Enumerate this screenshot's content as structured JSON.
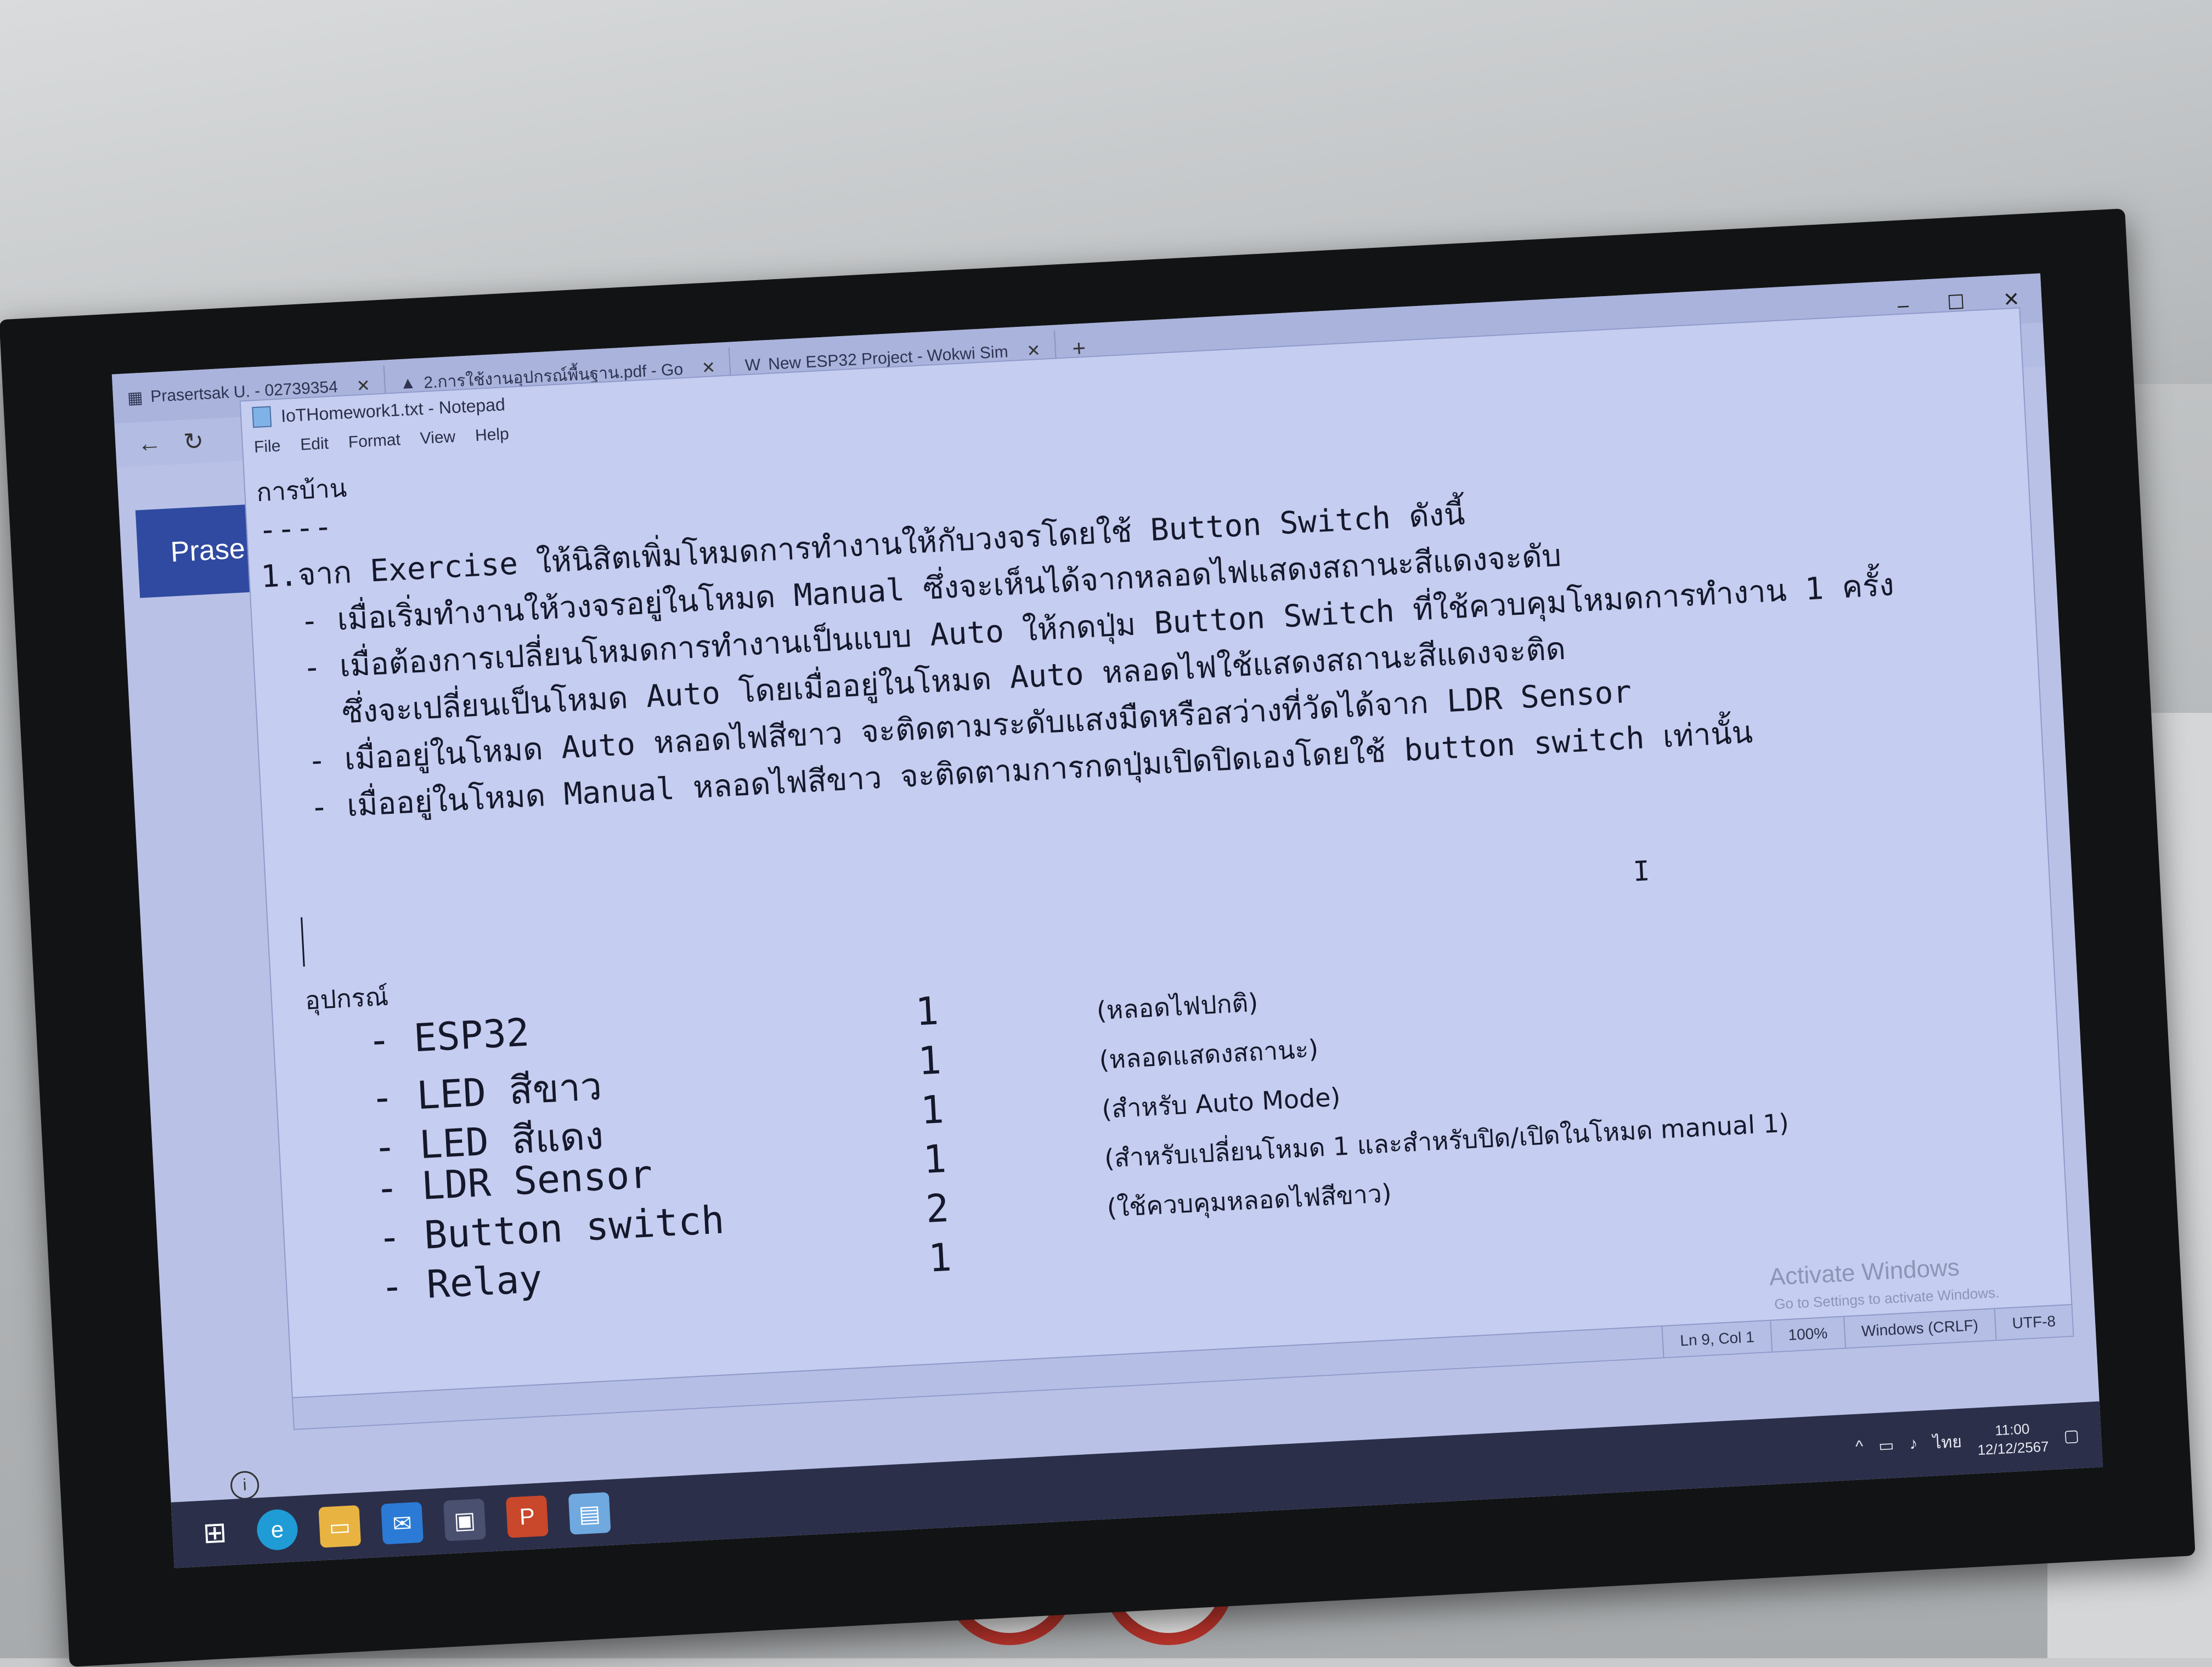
{
  "browser": {
    "tabs": [
      {
        "label": "Prasertsak U. - 02739354"
      },
      {
        "label": "2.การใช้งานอุปกรณ์พื้นฐาน.pdf - Go"
      },
      {
        "label": "New ESP32 Project - Wokwi Sim"
      }
    ],
    "plus": "+",
    "sidebar_label": "Prase"
  },
  "notepad": {
    "title": "IoTHomework1.txt - Notepad",
    "menu": [
      "File",
      "Edit",
      "Format",
      "View",
      "Help"
    ],
    "lines": [
      "การบ้าน",
      "----",
      "1.จาก Exercise ให้นิสิตเพิ่มโหมดการทำงานให้กับวงจรโดยใช้ Button Switch ดังนี้",
      "  - เมื่อเริ่มทำงานให้วงจรอยู่ในโหมด Manual ซึ่งจะเห็นได้จากหลอดไฟแสดงสถานะสีแดงจะดับ",
      "  - เมื่อต้องการเปลี่ยนโหมดการทำงานเป็นแบบ Auto ให้กดปุ่ม Button Switch ที่ใช้ควบคุมโหมดการทำงาน 1 ครั้ง",
      "    ซึ่งจะเปลี่ยนเป็นโหมด Auto โดยเมื่ออยู่ในโหมด Auto หลอดไฟใช้แสดงสถานะสีแดงจะติด",
      "  - เมื่ออยู่ในโหมด Auto หลอดไฟสีขาว จะติดตามระดับแสงมืดหรือสว่างที่วัดได้จาก LDR Sensor",
      "  - เมื่ออยู่ในโหมด Manual หลอดไฟสีขาว จะติดตามการกดปุ่มเปิดปิดเองโดยใช้ button switch เท่านั้น"
    ],
    "equipment_header": "อุปกรณ์",
    "equipment": [
      {
        "name": "- ESP32",
        "qty": "1",
        "note": "(หลอดไฟปกติ)"
      },
      {
        "name": "- LED สีขาว",
        "qty": "1",
        "note": "(หลอดแสดงสถานะ)"
      },
      {
        "name": "- LED สีแดง",
        "qty": "1",
        "note": "(สำหรับ Auto Mode)"
      },
      {
        "name": "- LDR Sensor",
        "qty": "1",
        "note": "(สำหรับเปลี่ยนโหมด 1 และสำหรับปิด/เปิดในโหมด manual 1)"
      },
      {
        "name": "- Button switch",
        "qty": "2",
        "note": "(ใช้ควบคุมหลอดไฟสีขาว)"
      },
      {
        "name": "- Relay",
        "qty": "1",
        "note": ""
      }
    ],
    "status": {
      "position": "Ln 9, Col 1",
      "zoom": "100%",
      "line_ending": "Windows (CRLF)",
      "encoding": "UTF-8"
    },
    "activate_title": "Activate Windows",
    "activate_sub": "Go to Settings to activate Windows."
  },
  "taskbar": {
    "language": "ไทย",
    "time": "11:00",
    "date": "12/12/2567"
  },
  "colors": {
    "screen_bg": "#b9c2e6",
    "brand_blue": "#2f4aa0",
    "taskbar": "#2b2f4a"
  }
}
